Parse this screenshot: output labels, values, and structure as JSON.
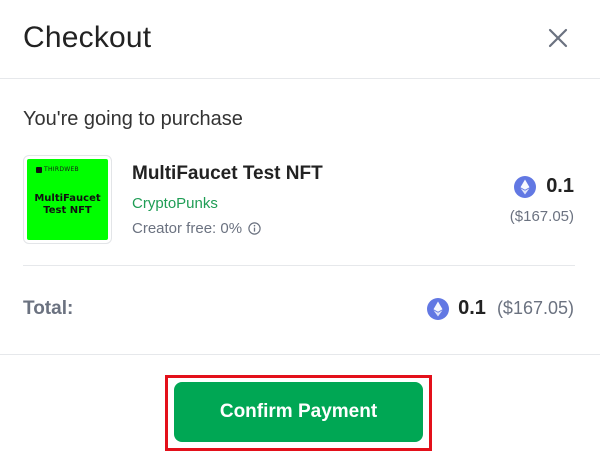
{
  "header": {
    "title": "Checkout",
    "close_icon": "close-icon"
  },
  "purchase": {
    "intro": "You're going to purchase",
    "item": {
      "thumbnail": {
        "brand": "THIRDWEB",
        "text_line1": "MultiFaucet",
        "text_line2": "Test NFT",
        "background": "#00ff00"
      },
      "name": "MultiFaucet Test NFT",
      "collection": "CryptoPunks",
      "creator_fee": "Creator free: 0%",
      "price": "0.1",
      "price_usd": "($167.05)",
      "currency_icon": "ethereum-icon"
    }
  },
  "total": {
    "label": "Total:",
    "price": "0.1",
    "price_usd": "($167.05)"
  },
  "footer": {
    "confirm_label": "Confirm Payment"
  },
  "colors": {
    "accent_green": "#00a754",
    "collection_green": "#1f9d55",
    "highlight_red": "#e3101a"
  }
}
